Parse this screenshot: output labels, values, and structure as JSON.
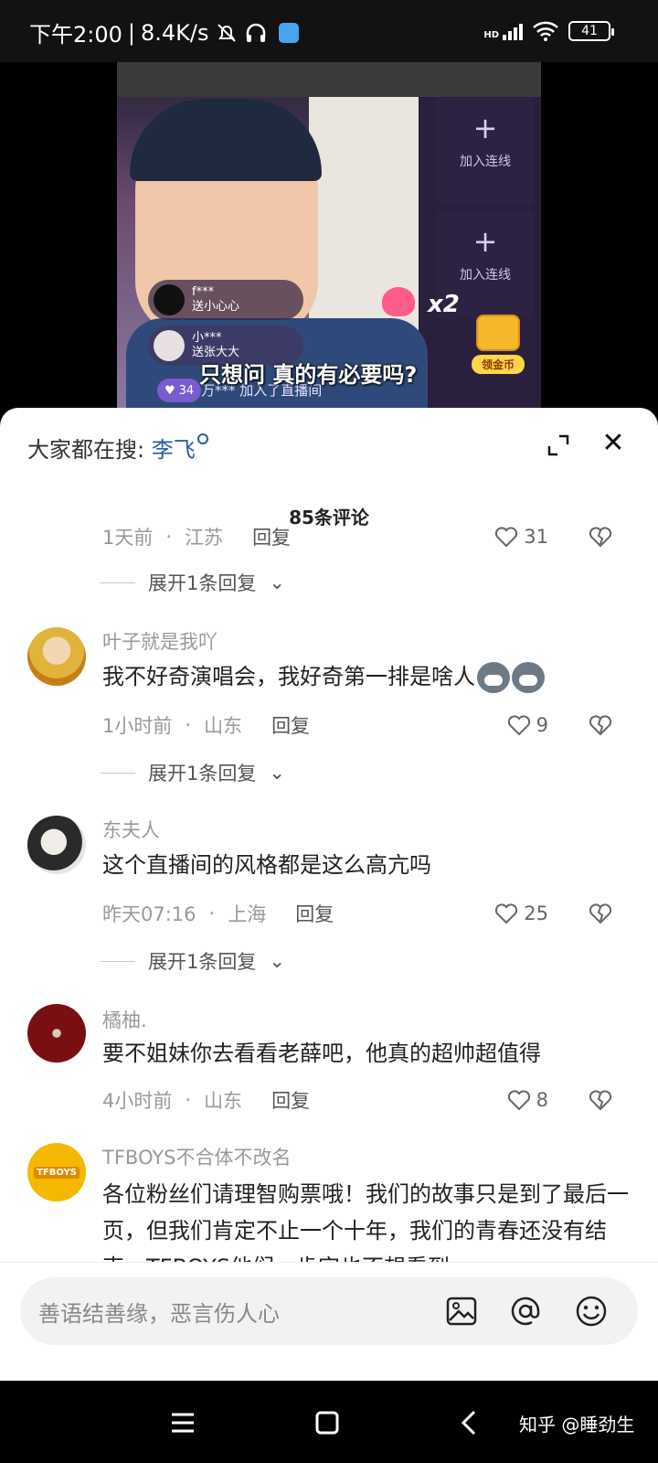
{
  "status_bar": {
    "time": "下午2:00",
    "speed": "8.4K/s",
    "signal_label": "HD",
    "battery": "41"
  },
  "video": {
    "slot1_label": "加入连线",
    "slot2_label": "加入连线",
    "gift1_user": "f***",
    "gift1_action": "送小心心",
    "gift2_user": "小***",
    "gift2_action": "送张大大",
    "combo": "x2",
    "subtitle": "只想问 真的有必要吗?",
    "viewers": "34",
    "join_text": "万*** 加入了直播间",
    "gold_coin_label": "领金币"
  },
  "sheet": {
    "search_prefix": "大家都在搜:",
    "search_keyword": "李飞",
    "comment_count": "85条评论"
  },
  "comments": [
    {
      "time": "1天前",
      "location": "江苏",
      "reply_label": "回复",
      "likes": "31",
      "expand": "展开1条回复"
    },
    {
      "user": "叶子就是我吖",
      "text": "我不好奇演唱会，我好奇第一排是啥人",
      "time": "1小时前",
      "location": "山东",
      "reply_label": "回复",
      "likes": "9",
      "expand": "展开1条回复"
    },
    {
      "user": "东夫人",
      "text": "这个直播间的风格都是这么高亢吗",
      "time": "昨天07:16",
      "location": "上海",
      "reply_label": "回复",
      "likes": "25",
      "expand": "展开1条回复"
    },
    {
      "user": "橘柚.",
      "text": "要不姐妹你去看看老薛吧，他真的超帅超值得",
      "time": "4小时前",
      "location": "山东",
      "reply_label": "回复",
      "likes": "8"
    },
    {
      "user": "TFBOYS不合体不改名",
      "text": "各位粉丝们请理智购票哦！我们的故事只是到了最后一页，但我们肯定不止一个十年，我们的青春还没有结束，TFBOYS他们一肯定也不想看到",
      "avatar_text": "TFBOYS"
    }
  ],
  "input": {
    "placeholder": "善语结善缘，恶言伤人心"
  },
  "watermark": "知乎 @睡劲生",
  "colors": {
    "accent_link": "#2a5c9a",
    "sheet_bg": "#ffffff",
    "text_primary": "#222222",
    "text_secondary": "#9a9a9a"
  }
}
